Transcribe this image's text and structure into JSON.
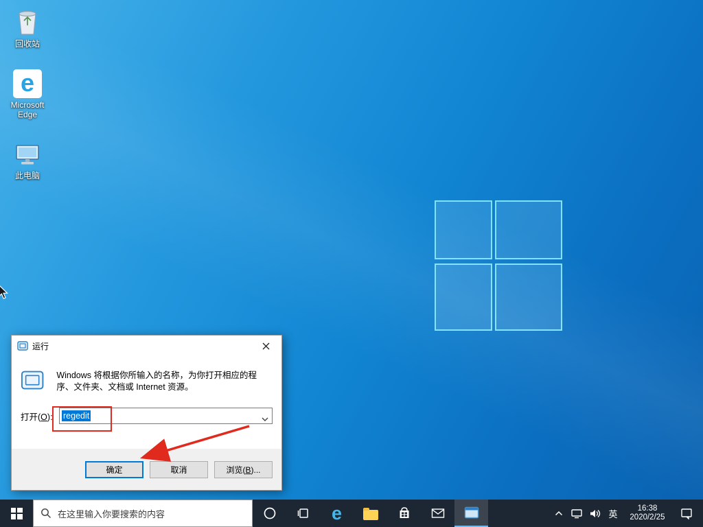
{
  "desktop": {
    "icons": [
      {
        "label": "回收站"
      },
      {
        "label": "Microsoft Edge"
      },
      {
        "label": "此电脑"
      }
    ]
  },
  "dialog": {
    "title": "运行",
    "description": "Windows 将根据你所输入的名称，为你打开相应的程序、文件夹、文档或 Internet 资源。",
    "open_label": {
      "pre": "打开(",
      "key": "O",
      "post": "):"
    },
    "input_value": "regedit",
    "buttons": {
      "ok": "确定",
      "cancel": "取消",
      "browse": {
        "pre": "浏览(",
        "key": "B",
        "post": ")..."
      }
    }
  },
  "taskbar": {
    "search_text": "在这里输入你要搜索的内容",
    "ime": "英",
    "clock": {
      "time": "16:38",
      "date": "2020/2/25"
    }
  },
  "colors": {
    "accent": "#0078d7",
    "annotation": "#e02a1d",
    "taskbar-bg": "#1d2733"
  }
}
